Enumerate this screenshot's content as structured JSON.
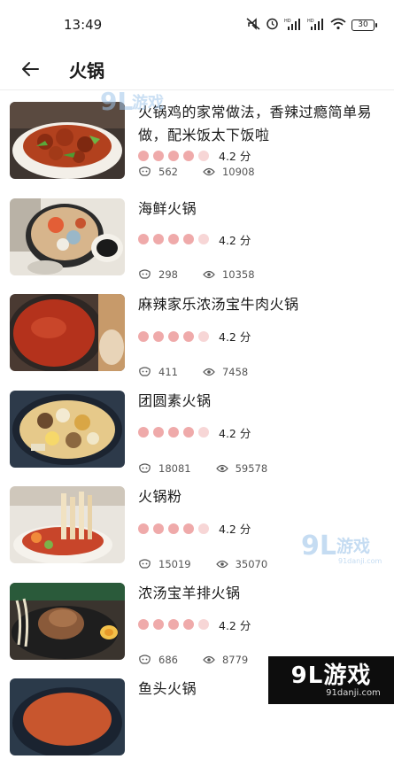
{
  "status_bar": {
    "time": "13:49",
    "battery": "30"
  },
  "app_bar": {
    "title": "火锅"
  },
  "items": [
    {
      "title": "火锅鸡的家常做法，香辣过瘾简单易做，配米饭太下饭啦",
      "rating": "4.2 分",
      "likes": "562",
      "views": "10908"
    },
    {
      "title": "海鲜火锅",
      "rating": "4.2 分",
      "likes": "298",
      "views": "10358"
    },
    {
      "title": "麻辣家乐浓汤宝牛肉火锅",
      "rating": "4.2 分",
      "likes": "411",
      "views": "7458"
    },
    {
      "title": "团圆素火锅",
      "rating": "4.2 分",
      "likes": "18081",
      "views": "59578"
    },
    {
      "title": "火锅粉",
      "rating": "4.2 分",
      "likes": "15019",
      "views": "35070"
    },
    {
      "title": "浓汤宝羊排火锅",
      "rating": "4.2 分",
      "likes": "686",
      "views": "8779"
    },
    {
      "title": "鱼头火锅",
      "rating": "",
      "likes": "",
      "views": ""
    }
  ],
  "watermark": {
    "logo": "9L游戏",
    "url": "91danji.com"
  },
  "colors": {
    "rating_dot": "#efaaaa",
    "rating_dot_light": "#f7d6d6"
  }
}
